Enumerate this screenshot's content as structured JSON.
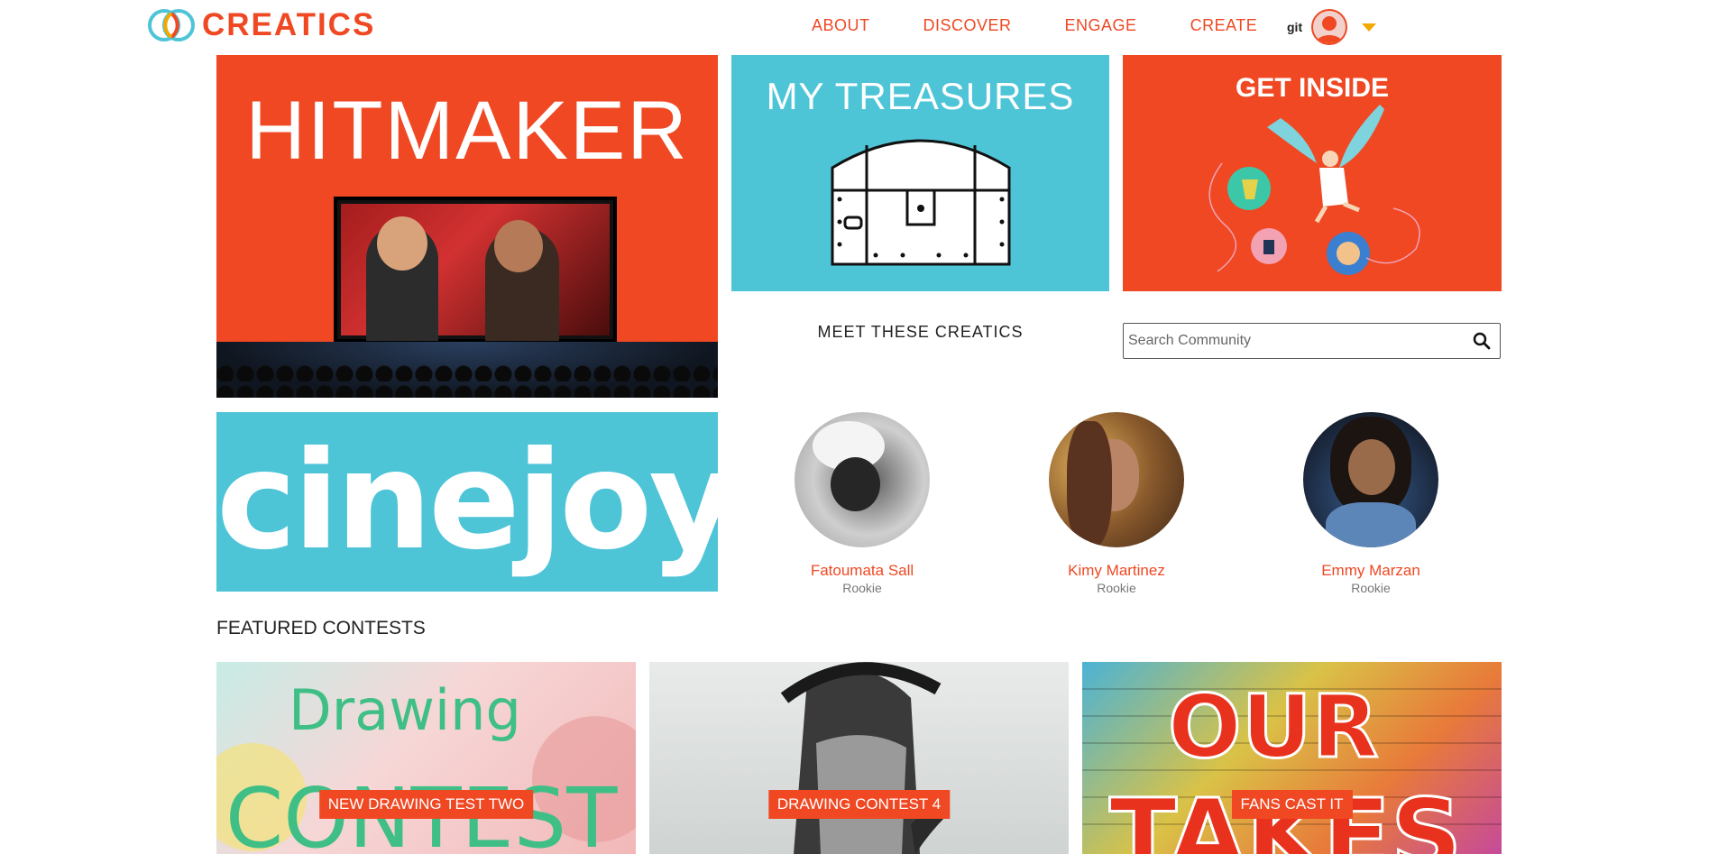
{
  "header": {
    "brand": "CREATICS",
    "nav": [
      "ABOUT",
      "DISCOVER",
      "ENGAGE",
      "CREATE"
    ],
    "user_name": "git"
  },
  "tiles": {
    "hitmaker": "HITMAKER",
    "treasures": "MY TREASURES",
    "get_inside": "GET INSIDE",
    "cinejoy": "cinejoy"
  },
  "community": {
    "heading": "MEET  THESE  CREATICS",
    "search_placeholder": "Search Community",
    "members": [
      {
        "name": "Fatoumata Sall",
        "rank": "Rookie"
      },
      {
        "name": "Kimy Martinez",
        "rank": "Rookie"
      },
      {
        "name": "Emmy Marzan",
        "rank": "Rookie"
      }
    ]
  },
  "featured": {
    "heading": "FEATURED CONTESTS",
    "contests": [
      {
        "label": "NEW DRAWING TEST TWO",
        "art_text": "Drawing CONTEST"
      },
      {
        "label": "DRAWING CONTEST 4"
      },
      {
        "label": "FANS CAST IT",
        "art_text": "OUR TAKES"
      }
    ]
  },
  "colors": {
    "brand_orange": "#ef4823",
    "brand_teal": "#4ec4d7",
    "caret_yellow": "#f2a900"
  }
}
